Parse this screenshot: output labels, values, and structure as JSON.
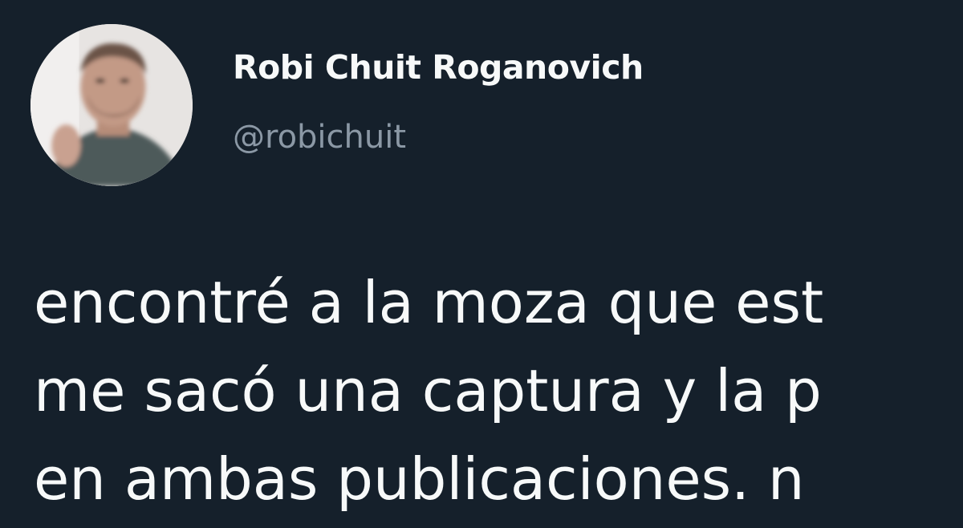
{
  "tweet": {
    "author": {
      "display_name": "Robi Chuit Roganovich",
      "handle": "@robichuit",
      "avatar_icon": "profile-photo"
    },
    "text_lines": [
      "encontré a la moza que est",
      "me sacó una captura y la p",
      "en ambas publicaciones. n"
    ]
  },
  "colors": {
    "background": "#15202b",
    "text_primary": "#f7f9f9",
    "text_secondary": "#8b98a5"
  }
}
